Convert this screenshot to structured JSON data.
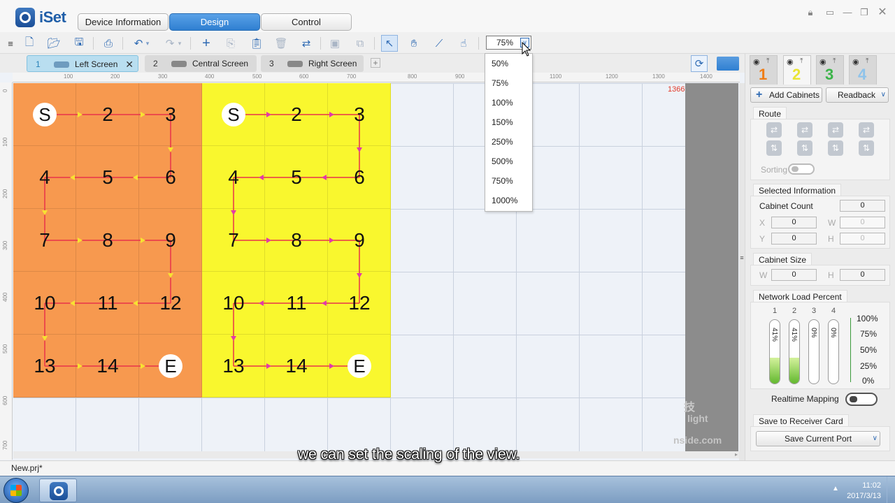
{
  "app": {
    "name": "iSet"
  },
  "main_tabs": [
    {
      "label": "Device Information"
    },
    {
      "label": "Design"
    },
    {
      "label": "Control"
    }
  ],
  "zoom": {
    "current": "75%",
    "options": [
      "50%",
      "75%",
      "100%",
      "150%",
      "250%",
      "500%",
      "750%",
      "1000%"
    ]
  },
  "screen_tabs": [
    {
      "num": "1",
      "label": "Left Screen"
    },
    {
      "num": "2",
      "label": "Central Screen"
    },
    {
      "num": "3",
      "label": "Right Screen"
    }
  ],
  "ruler": {
    "top": [
      "100",
      "200",
      "300",
      "400",
      "500",
      "600",
      "700",
      "800",
      "900",
      "1000",
      "1100",
      "1200",
      "1300",
      "1400"
    ],
    "left": [
      "0",
      "100",
      "200",
      "300",
      "400",
      "500",
      "600",
      "700"
    ]
  },
  "canvas": {
    "width_label": "1366",
    "watermark": [
      "技",
      "light",
      "nside.com"
    ],
    "screens": [
      {
        "color": "#f7994f",
        "route_color": "#e8334a",
        "arrow_color": "#f7e232",
        "cells": [
          "S",
          "2",
          "3",
          "6",
          "5",
          "4",
          "7",
          "8",
          "9",
          "12",
          "11",
          "10",
          "13",
          "14",
          "E"
        ]
      },
      {
        "color": "#f9f72e",
        "route_color": "#e8334a",
        "arrow_color": "#e23aa8",
        "cells": [
          "S",
          "2",
          "3",
          "6",
          "5",
          "4",
          "7",
          "8",
          "9",
          "12",
          "11",
          "10",
          "13",
          "14",
          "E"
        ]
      }
    ]
  },
  "right_panel": {
    "tabs": [
      {
        "num": "1",
        "color": "#ef7d16"
      },
      {
        "num": "2",
        "color": "#e9e534"
      },
      {
        "num": "3",
        "color": "#3bb449"
      },
      {
        "num": "4",
        "color": "#8fc3ea"
      }
    ],
    "add_cabinets": "Add Cabinets",
    "readback": "Readback",
    "route_title": "Route",
    "sorting": "Sorting",
    "selected_info": {
      "title": "Selected Information",
      "cabinet_count_label": "Cabinet Count",
      "cabinet_count": "0",
      "x_label": "X",
      "x": "0",
      "w_label": "W",
      "w": "0",
      "y_label": "Y",
      "y": "0",
      "h_label": "H",
      "h": "0"
    },
    "cabinet_size": {
      "title": "Cabinet Size",
      "w_label": "W",
      "w": "0",
      "h_label": "H",
      "h": "0"
    },
    "network_load": {
      "title": "Network Load Percent",
      "ports": [
        {
          "num": "1",
          "percent": 41,
          "label": "41%"
        },
        {
          "num": "2",
          "percent": 41,
          "label": "41%"
        },
        {
          "num": "3",
          "percent": 0,
          "label": "0%"
        },
        {
          "num": "4",
          "percent": 0,
          "label": "0%"
        }
      ],
      "scale": [
        "100%",
        "75%",
        "50%",
        "25%",
        "0%"
      ]
    },
    "realtime_mapping": "Realtime Mapping",
    "save_section": "Save to Receiver Card",
    "save_current_port": "Save Current Port"
  },
  "status": {
    "file": "New.prj*"
  },
  "caption": "we can set the scaling of the view.",
  "taskbar": {
    "time": "11:02",
    "date": "2017/3/13"
  }
}
